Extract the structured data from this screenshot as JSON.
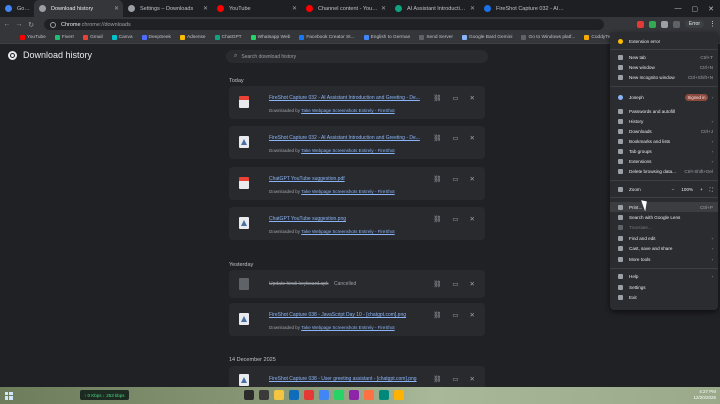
{
  "tabs": [
    {
      "title": "Google",
      "fav_color": "#4285f4",
      "active": false
    },
    {
      "title": "Download history",
      "fav_color": "#9aa0a6",
      "active": true
    },
    {
      "title": "Settings – Downloads",
      "fav_color": "#9aa0a6",
      "active": false
    },
    {
      "title": "YouTube",
      "fav_color": "#ff0000",
      "active": false
    },
    {
      "title": "Channel content - YouTube Stu",
      "fav_color": "#ff0000",
      "active": false
    },
    {
      "title": "AI Assistant Introduction and G",
      "fav_color": "#10a37f",
      "active": false
    },
    {
      "title": "FireShot Capture 032 - AI Assi",
      "fav_color": "#1a73e8",
      "active": false
    }
  ],
  "omnibox": {
    "site": "Chrome",
    "path": "chrome://downloads"
  },
  "profile_label": "Error",
  "bookmarks": [
    "YouTube",
    "Fiverr",
    "Gmail",
    "Canva",
    "DeepSeek",
    "Adsense",
    "ChatGPT",
    "Whatsapp Web",
    "Facebook Creator St...",
    "English to German",
    "Send Server",
    "Google Bard Gemini",
    "Go to Windows platf...",
    "CoddyTech",
    "German + English"
  ],
  "page": {
    "title": "Download history",
    "search_placeholder": "Search download history"
  },
  "sections": [
    "Today",
    "Yesterday",
    "14 December 2025"
  ],
  "downloads": [
    {
      "name": "FireShot Capture 032 - AI Assistant Introduction and Greeting - De...",
      "type": "pdf",
      "prefix": "Downloaded by",
      "source": "Take Webpage Screenshots Entirely - FireShot"
    },
    {
      "name": "FireShot Capture 032 - AI Assistant Introduction and Greeting - De...",
      "type": "png",
      "prefix": "Downloaded by",
      "source": "Take Webpage Screenshots Entirely - FireShot"
    },
    {
      "name": "ChatGPT YouTube suggestion.pdf",
      "type": "pdf",
      "prefix": "Downloaded by",
      "source": "Take Webpage Screenshots Entirely - FireShot"
    },
    {
      "name": "ChatGPT YouTube suggestion.png",
      "type": "png",
      "prefix": "Downloaded by",
      "source": "Take Webpage Screenshots Entirely - FireShot"
    },
    {
      "name": "Update hindi keyboard.apk",
      "type": "doc",
      "status": "Cancelled"
    },
    {
      "name": "FireShot Capture 038 - JavaScript Day 10 - [chatgpt.com].png",
      "type": "png",
      "prefix": "Downloaded by",
      "source": "Take Webpage Screenshots Entirely - FireShot"
    },
    {
      "name": "FireShot Capture 038 - User greeting assistant - [chatgpt.com].png",
      "type": "png"
    }
  ],
  "menu": {
    "extension_error": "Extension error",
    "new_tab": "New tab",
    "new_tab_sc": "Ctrl+T",
    "new_window": "New window",
    "new_window_sc": "Ctrl+N",
    "incognito": "New Incognito window",
    "incognito_sc": "Ctrl+Shift+N",
    "profile_name": "Joseph",
    "signed_in": "Signed in",
    "passwords": "Passwords and autofill",
    "history": "History",
    "downloads": "Downloads",
    "downloads_sc": "Ctrl+J",
    "bookmarks": "Bookmarks and lists",
    "tab_groups": "Tab groups",
    "extensions": "Extensions",
    "clear_data": "Delete browsing data...",
    "clear_data_sc": "Ctrl+Shift+Del",
    "zoom": "Zoom",
    "zoom_minus": "−",
    "zoom_value": "100%",
    "zoom_plus": "+",
    "print": "Print...",
    "print_sc": "Ctrl+P",
    "lens": "Search with Google Lens",
    "translate": "Translate...",
    "find_edit": "Find and edit",
    "cast_save": "Cast, save and share",
    "more_tools": "More tools",
    "help": "Help",
    "settings": "Settings",
    "exit": "Exit"
  },
  "taskbar": {
    "net": "↑ 0 Kbps  ↓ 253 kbps",
    "time": "4:27 PM",
    "date": "12/20/2025"
  }
}
